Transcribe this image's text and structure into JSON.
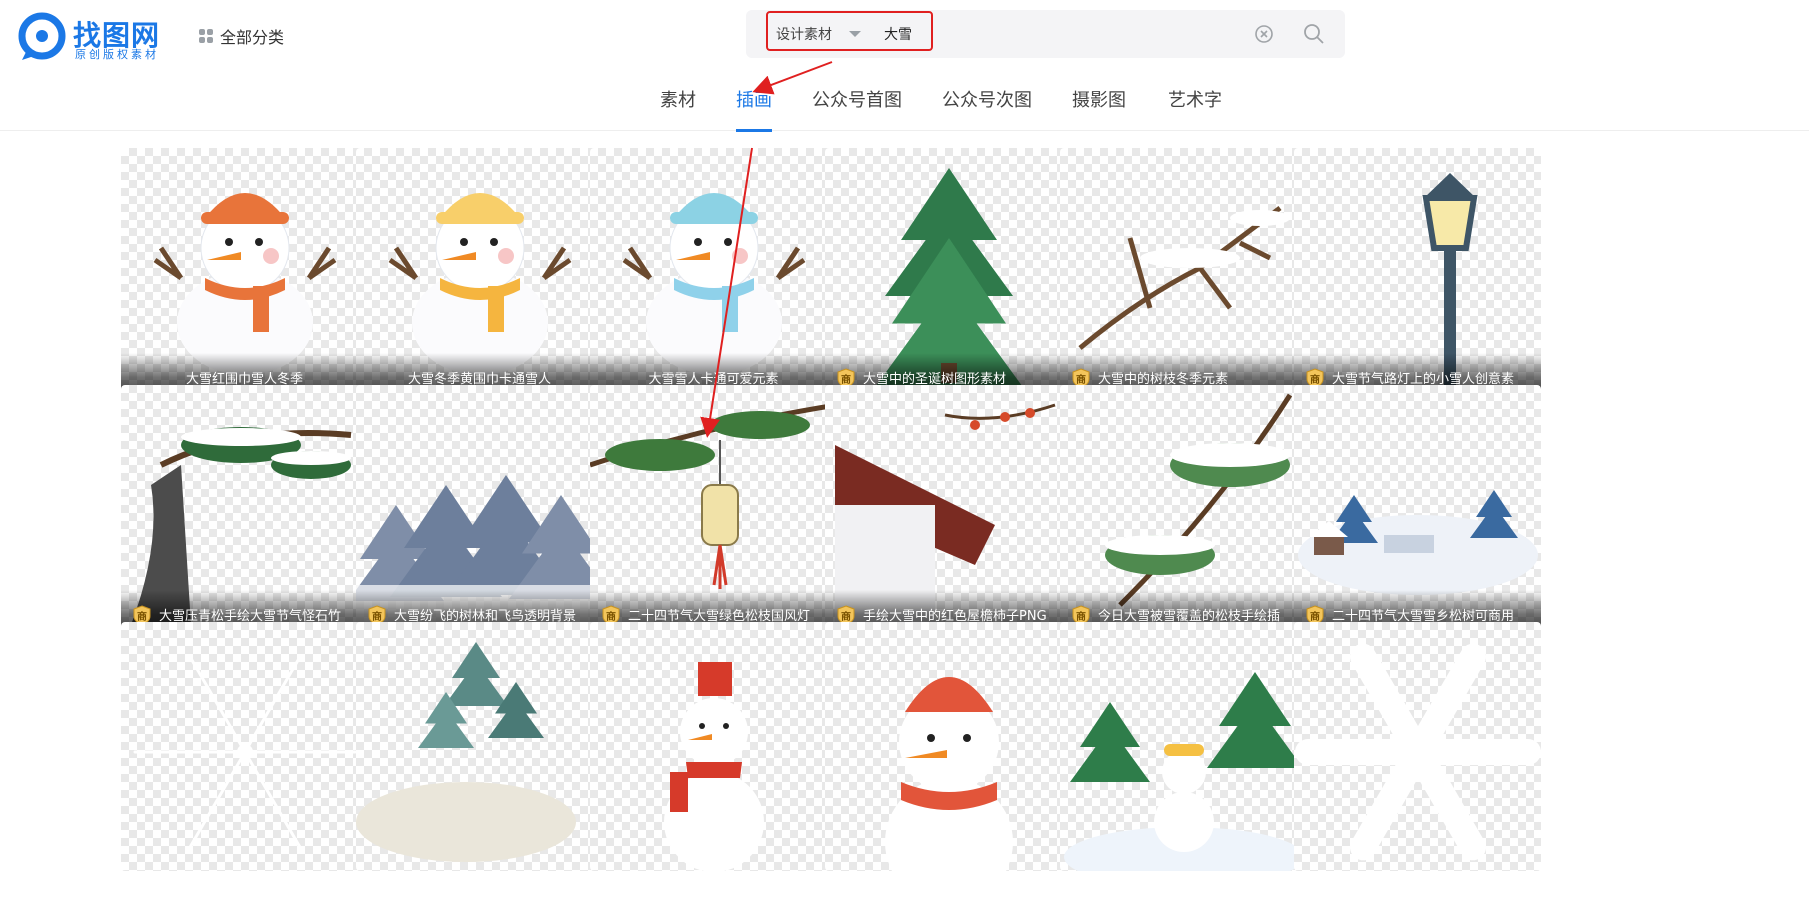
{
  "brand": {
    "name": "找图网",
    "tagline": "原创版权素材",
    "color": "#1b78e6"
  },
  "header": {
    "all_categories": "全部分类",
    "all_categories_icon": "grid-icon"
  },
  "search": {
    "type_label": "设计素材",
    "query": "大雪",
    "clear_icon": "clear-icon",
    "search_icon": "search-icon"
  },
  "tabs": [
    {
      "label": "素材",
      "active": false
    },
    {
      "label": "插画",
      "active": true
    },
    {
      "label": "公众号首图",
      "active": false
    },
    {
      "label": "公众号次图",
      "active": false
    },
    {
      "label": "摄影图",
      "active": false
    },
    {
      "label": "艺术字",
      "active": false
    }
  ],
  "badge_label": "商",
  "annotation_color": "#e02020",
  "results": [
    {
      "title": "大雪红围巾雪人冬季",
      "commercial": false,
      "art": "snowman-orange"
    },
    {
      "title": "大雪冬季黄围巾卡通雪人",
      "commercial": false,
      "art": "snowman-yellow"
    },
    {
      "title": "大雪雪人卡通可爱元素",
      "commercial": false,
      "art": "snowman-blue"
    },
    {
      "title": "大雪中的圣诞树图形素材",
      "commercial": true,
      "art": "christmas-tree"
    },
    {
      "title": "大雪中的树枝冬季元素",
      "commercial": true,
      "art": "snowy-branch"
    },
    {
      "title": "大雪节气路灯上的小雪人创意素",
      "commercial": true,
      "art": "street-lamp"
    },
    {
      "title": "大雪压青松手绘大雪节气怪石竹",
      "commercial": true,
      "art": "pine-rock"
    },
    {
      "title": "大雪纷飞的树林和飞鸟透明背景",
      "commercial": true,
      "art": "misty-forest"
    },
    {
      "title": "二十四节气大雪绿色松枝国风灯",
      "commercial": true,
      "art": "pine-lantern"
    },
    {
      "title": "手绘大雪中的红色屋檐柿子PNG",
      "commercial": true,
      "art": "red-eave"
    },
    {
      "title": "今日大雪被雪覆盖的松枝手绘插",
      "commercial": true,
      "art": "snow-pine"
    },
    {
      "title": "二十四节气大雪雪乡松树可商用",
      "commercial": true,
      "art": "snow-village"
    },
    {
      "title": "",
      "commercial": false,
      "art": "snowflake-thin"
    },
    {
      "title": "",
      "commercial": false,
      "art": "forest-hill"
    },
    {
      "title": "",
      "commercial": false,
      "art": "snowman-bucket"
    },
    {
      "title": "",
      "commercial": false,
      "art": "snowman-redhat"
    },
    {
      "title": "",
      "commercial": false,
      "art": "snowman-trees"
    },
    {
      "title": "",
      "commercial": false,
      "art": "snowflake-bold"
    }
  ]
}
